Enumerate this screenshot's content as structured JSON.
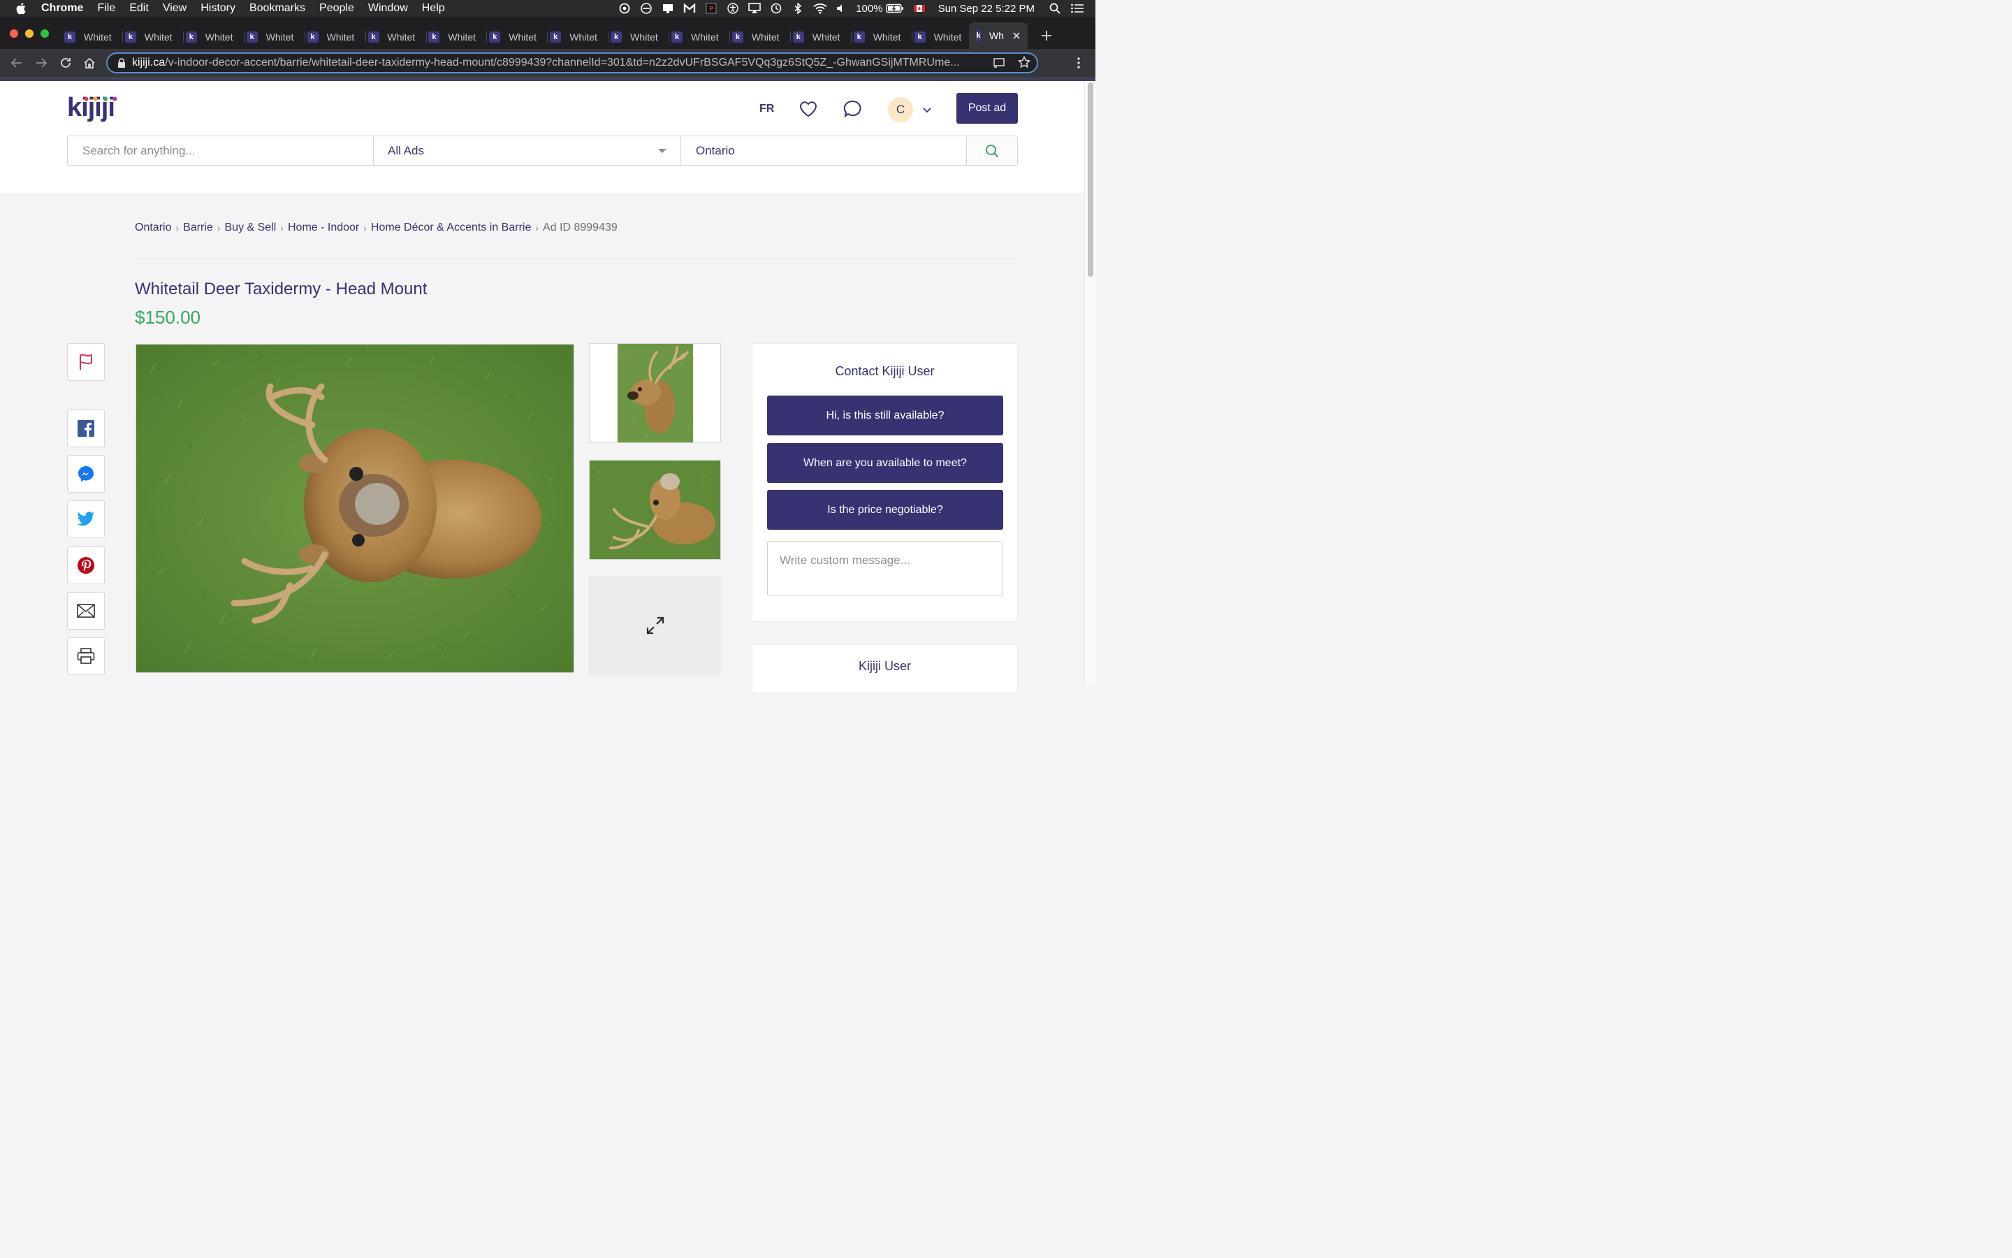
{
  "menubar": {
    "app_name": "Chrome",
    "menus": [
      "File",
      "Edit",
      "View",
      "History",
      "Bookmarks",
      "People",
      "Window",
      "Help"
    ],
    "battery": "100%",
    "datetime": "Sun Sep 22  5:22 PM"
  },
  "tabs": {
    "inactive_label": "Whitet",
    "active_label": "Wh",
    "favicon_letter": "k",
    "count": 16
  },
  "address_bar": {
    "host": "kijiji.ca",
    "path": "/v-indoor-decor-accent/barrie/whitetail-deer-taxidermy-head-mount/c8999439?channelId=301&td=n2z2dvUFrBSGAF5VQq3gz6StQ5Z_-GhwanGSijMTMRUme..."
  },
  "header": {
    "logo_text": "kijiji",
    "lang_toggle": "FR",
    "avatar_initial": "C",
    "post_ad_label": "Post ad"
  },
  "search": {
    "placeholder": "Search for anything...",
    "category": "All Ads",
    "location": "Ontario"
  },
  "breadcrumb": {
    "items": [
      "Ontario",
      "Barrie",
      "Buy & Sell",
      "Home - Indoor",
      "Home Décor & Accents in Barrie"
    ],
    "ad_id": "Ad ID 8999439"
  },
  "listing": {
    "title": "Whitetail Deer Taxidermy - Head Mount",
    "price": "$150.00"
  },
  "contact": {
    "heading": "Contact Kijiji User",
    "quick_replies": [
      "Hi, is this still available?",
      "When are you available to meet?",
      "Is the price negotiable?"
    ],
    "custom_placeholder": "Write custom message...",
    "seller_name": "Kijiji User"
  },
  "colors": {
    "brand": "#373373",
    "price_green": "#37a864",
    "report_red": "#d9304f",
    "facebook": "#3b5998",
    "messenger": "#1877f2",
    "twitter": "#1da1f2",
    "pinterest": "#bd081c"
  },
  "icons": {
    "social": [
      "report-flag-icon",
      "facebook-icon",
      "messenger-icon",
      "twitter-icon",
      "pinterest-icon",
      "email-icon",
      "print-icon"
    ]
  }
}
